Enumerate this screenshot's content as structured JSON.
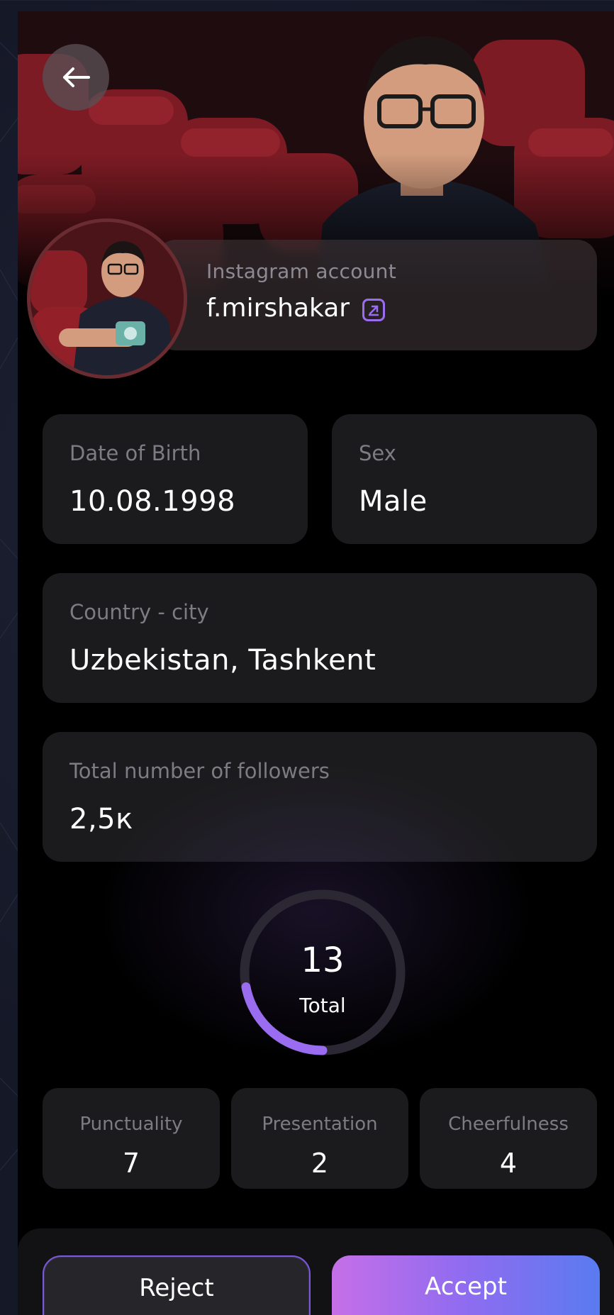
{
  "profile": {
    "instagram_label": "Instagram account",
    "instagram_handle": "f.mirshakar"
  },
  "fields": {
    "dob_label": "Date of Birth",
    "dob_value": "10.08.1998",
    "sex_label": "Sex",
    "sex_value": "Male",
    "location_label": "Country - city",
    "location_value": "Uzbekistan, Tashkent",
    "followers_label": "Total number of followers",
    "followers_value": "2,5к"
  },
  "score": {
    "total_value": "13",
    "total_label": "Total",
    "progress_fraction": 0.22,
    "ring_color": "#9a6cf0",
    "track_color": "#2b2733"
  },
  "ratings": [
    {
      "label": "Punctuality",
      "value": "7"
    },
    {
      "label": "Presentation",
      "value": "2"
    },
    {
      "label": "Cheerfulness",
      "value": "4"
    }
  ],
  "actions": {
    "reject_label": "Reject",
    "accept_label": "Accept"
  },
  "icons": {
    "back": "arrow-left-icon",
    "external": "external-link-icon"
  }
}
